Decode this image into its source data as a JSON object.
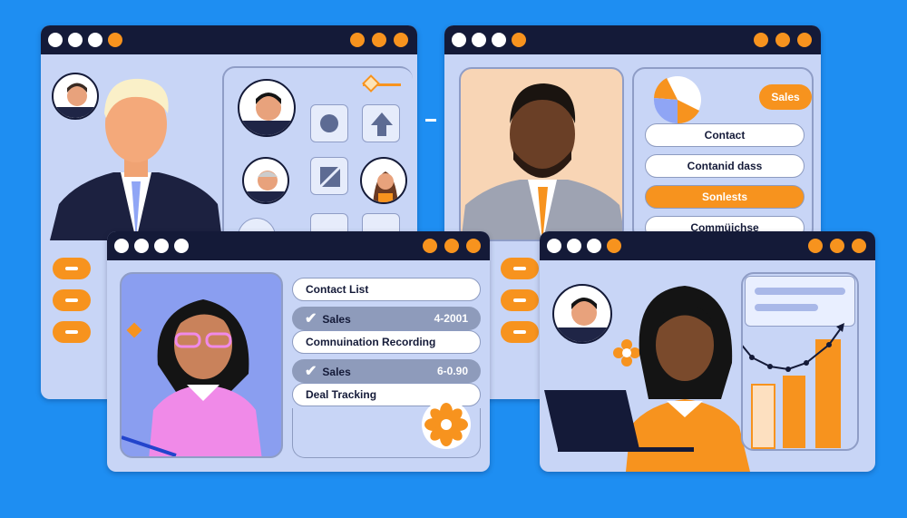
{
  "colors": {
    "background": "#1e8ef2",
    "titlebar": "#141a38",
    "window": "#c8d5f6",
    "accent": "#f7931e"
  },
  "window_top_right": {
    "badge": "Sales",
    "list": [
      "Contact",
      "Contanid dass",
      "Sonlests",
      "Commüichse"
    ]
  },
  "window_bottom_left": {
    "list": [
      {
        "label": "Contact List"
      },
      {
        "label": "Sales",
        "value": "4-2001",
        "checked": true
      },
      {
        "label": "Comnuination Recording"
      },
      {
        "label": "Sales",
        "value": "6-0.90",
        "checked": true
      },
      {
        "label": "Deal Tracking"
      }
    ]
  },
  "window_bottom_right": {
    "chart_icon": "bar-chart-with-trend-line"
  }
}
